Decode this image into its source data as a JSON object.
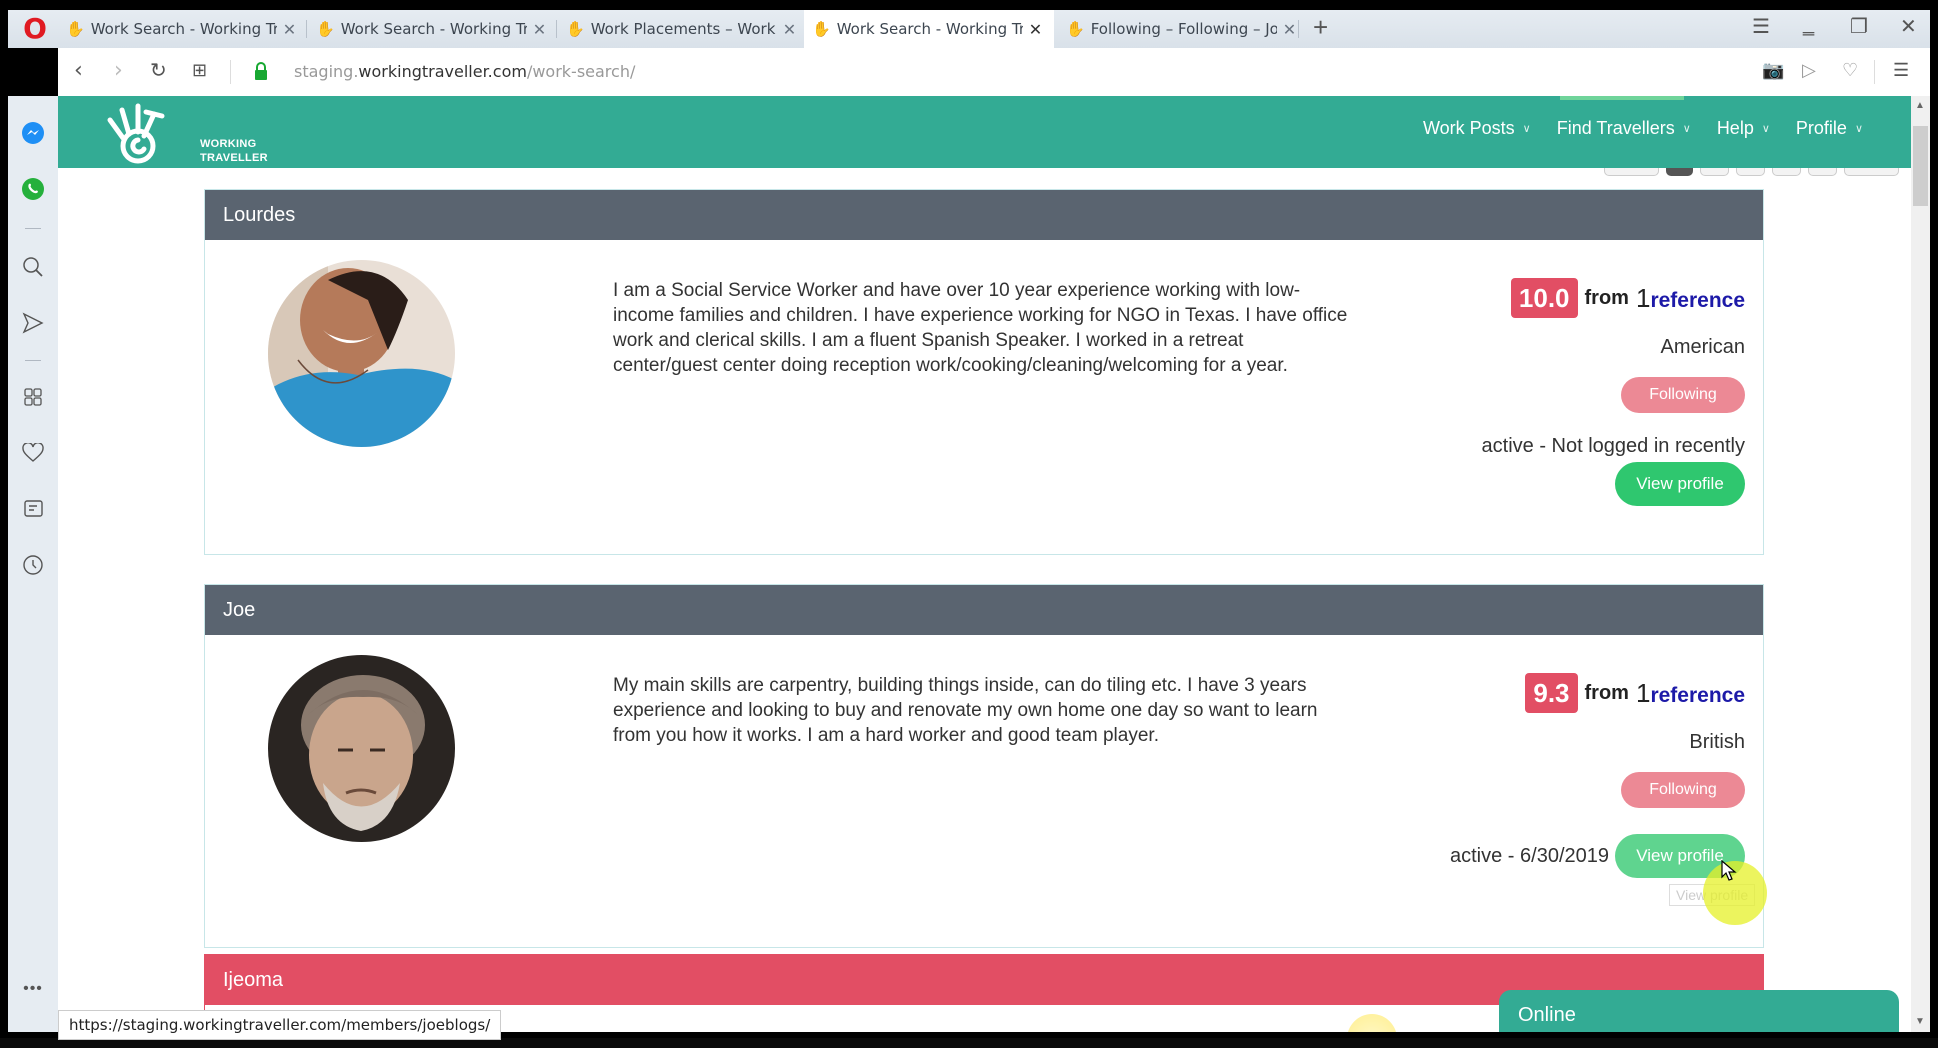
{
  "browser": {
    "tabs": [
      {
        "title": "Work Search - Working Tra",
        "active": false
      },
      {
        "title": "Work Search - Working Tra",
        "active": false
      },
      {
        "title": "Work Placements – Work P",
        "active": false
      },
      {
        "title": "Work Search - Working Tra",
        "active": true
      },
      {
        "title": "Following – Following – Jol",
        "active": false
      }
    ],
    "tab_close_glyph": "✕",
    "new_tab_glyph": "+",
    "url_prefix": "staging.",
    "url_domain": "workingtraveller.com",
    "url_path": "/work-search/",
    "status_url": "https://staging.workingtraveller.com/members/joeblogs/",
    "sidebar_icons": [
      "messenger-icon",
      "whatsapp-icon",
      "search-icon",
      "send-icon",
      "speed-dial-icon",
      "heart-icon",
      "news-icon",
      "history-icon",
      "more-icon"
    ]
  },
  "site": {
    "logo_line1": "WORKING",
    "logo_line2": "TRAVELLER",
    "nav": [
      {
        "label": "Work Posts"
      },
      {
        "label": "Find Travellers"
      },
      {
        "label": "Help"
      },
      {
        "label": "Profile"
      }
    ],
    "brand_color": "#33ab94",
    "accent_red": "#e24e64",
    "accent_green": "#2fc76f"
  },
  "profiles": [
    {
      "name": "Lourdes",
      "bio": "I am a Social Service Worker and have over 10 year experience working with low-income families and children. I have experience working for NGO in Texas. I have office work and clerical skills. I am a fluent Spanish Speaker. I worked in a retreat center/guest center doing reception work/cooking/cleaning/welcoming for a year.",
      "score": "10.0",
      "from": "from",
      "ref_count": "1",
      "ref_label": "reference",
      "nationality": "American",
      "follow_label": "Following",
      "status": "active - Not logged in recently",
      "view_label": "View profile"
    },
    {
      "name": "Joe",
      "bio": "My main skills are carpentry, building things inside, can do tiling etc. I have 3 years experience and looking to buy and renovate my own home one day so want to learn from you how it works. I am a hard worker and good team player.",
      "score": "9.3",
      "from": "from",
      "ref_count": "1",
      "ref_label": "reference",
      "nationality": "British",
      "follow_label": "Following",
      "status": "active - 6/30/2019",
      "view_label": "View profile"
    },
    {
      "name": "Ijeoma"
    }
  ],
  "tooltip": "View profile",
  "chat": {
    "label": "Online"
  }
}
